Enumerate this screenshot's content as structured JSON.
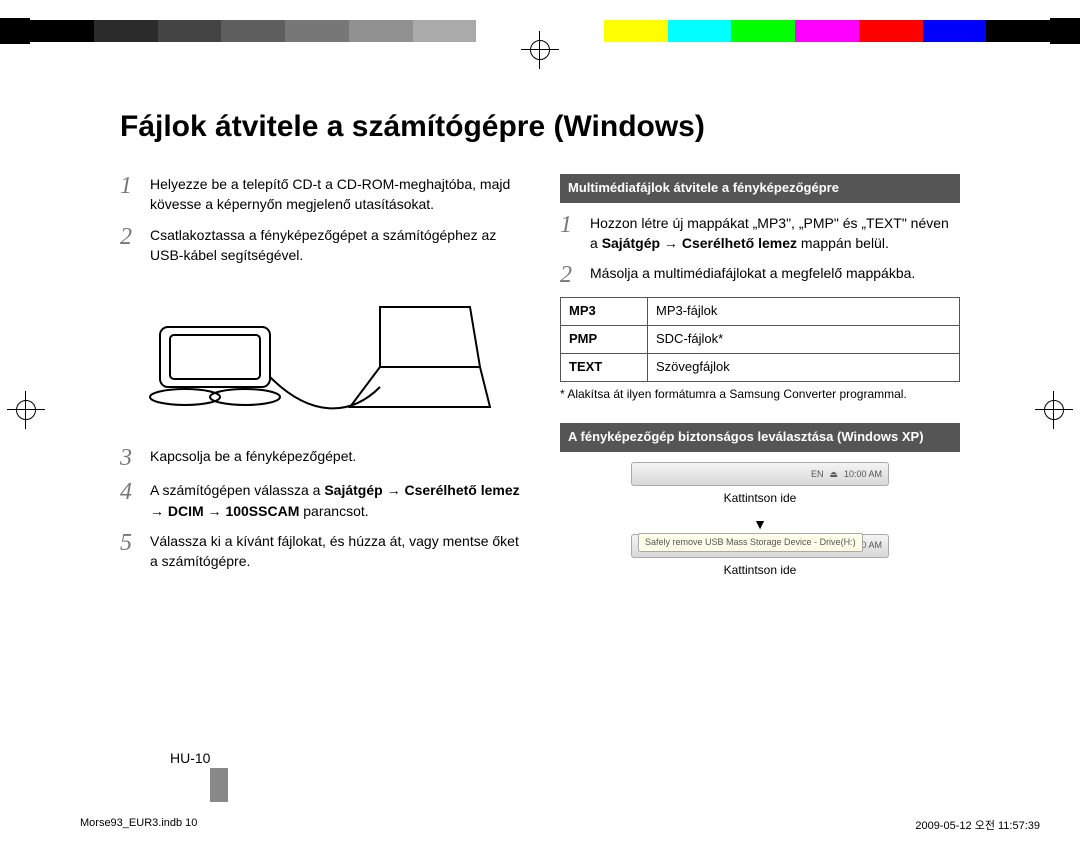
{
  "title": "Fájlok átvitele a számítógépre (Windows)",
  "left": {
    "s1": "Helyezze be a telepítő CD-t a CD-ROM-meghajtóba, majd kövesse a képernyőn megjelenő utasításokat.",
    "s2": "Csatlakoztassa a fényképezőgépet a számítógéphez az USB-kábel segítségével.",
    "s3": "Kapcsolja be a fényképezőgépet.",
    "s4_a": "A számítógépen válassza a ",
    "s4_b": "Sajátgép",
    "s4_c": " → ",
    "s4_d": "Cserélhető lemez",
    "s4_e": " → ",
    "s4_f": "DCIM",
    "s4_g": " → ",
    "s4_h": "100SSCAM",
    "s4_i": " parancsot.",
    "s5": "Válassza ki a kívánt fájlokat, és húzza át, vagy mentse őket a számítógépre."
  },
  "right": {
    "head1": "Multimédiafájlok átvitele a fényképezőgépre",
    "r1_a": "Hozzon létre új mappákat „MP3\", „PMP\" és „TEXT\" néven a ",
    "r1_b": "Sajátgép",
    "r1_c": " → ",
    "r1_d": "Cserélhető lemez",
    "r1_e": " mappán belül.",
    "r2": "Másolja a multimédiafájlokat a megfelelő mappákba.",
    "table": [
      {
        "k": "MP3",
        "v": "MP3-fájlok"
      },
      {
        "k": "PMP",
        "v": "SDC-fájlok*"
      },
      {
        "k": "TEXT",
        "v": "Szövegfájlok"
      }
    ],
    "foot": "* Alakítsa át ilyen formátumra a Samsung Converter programmal.",
    "head2": "A fényképezőgép biztonságos leválasztása (Windows XP)",
    "click": "Kattintson ide",
    "balloon": "Safely remove USB Mass Storage Device - Drive(H:)",
    "tray_en": "EN",
    "tray_time": "10:00 AM"
  },
  "page_number": "HU-10",
  "print_file": "Morse93_EUR3.indb   10",
  "print_date": "2009-05-12   오전 11:57:39",
  "colorbar": [
    "#000000",
    "#2b2b2b",
    "#444444",
    "#5e5e5e",
    "#777777",
    "#909090",
    "#aaaaaa",
    "#ffffff",
    "#ffffff",
    "#ffff00",
    "#00ffff",
    "#00ff00",
    "#ff00ff",
    "#ff0000",
    "#0000ff",
    "#000000"
  ]
}
